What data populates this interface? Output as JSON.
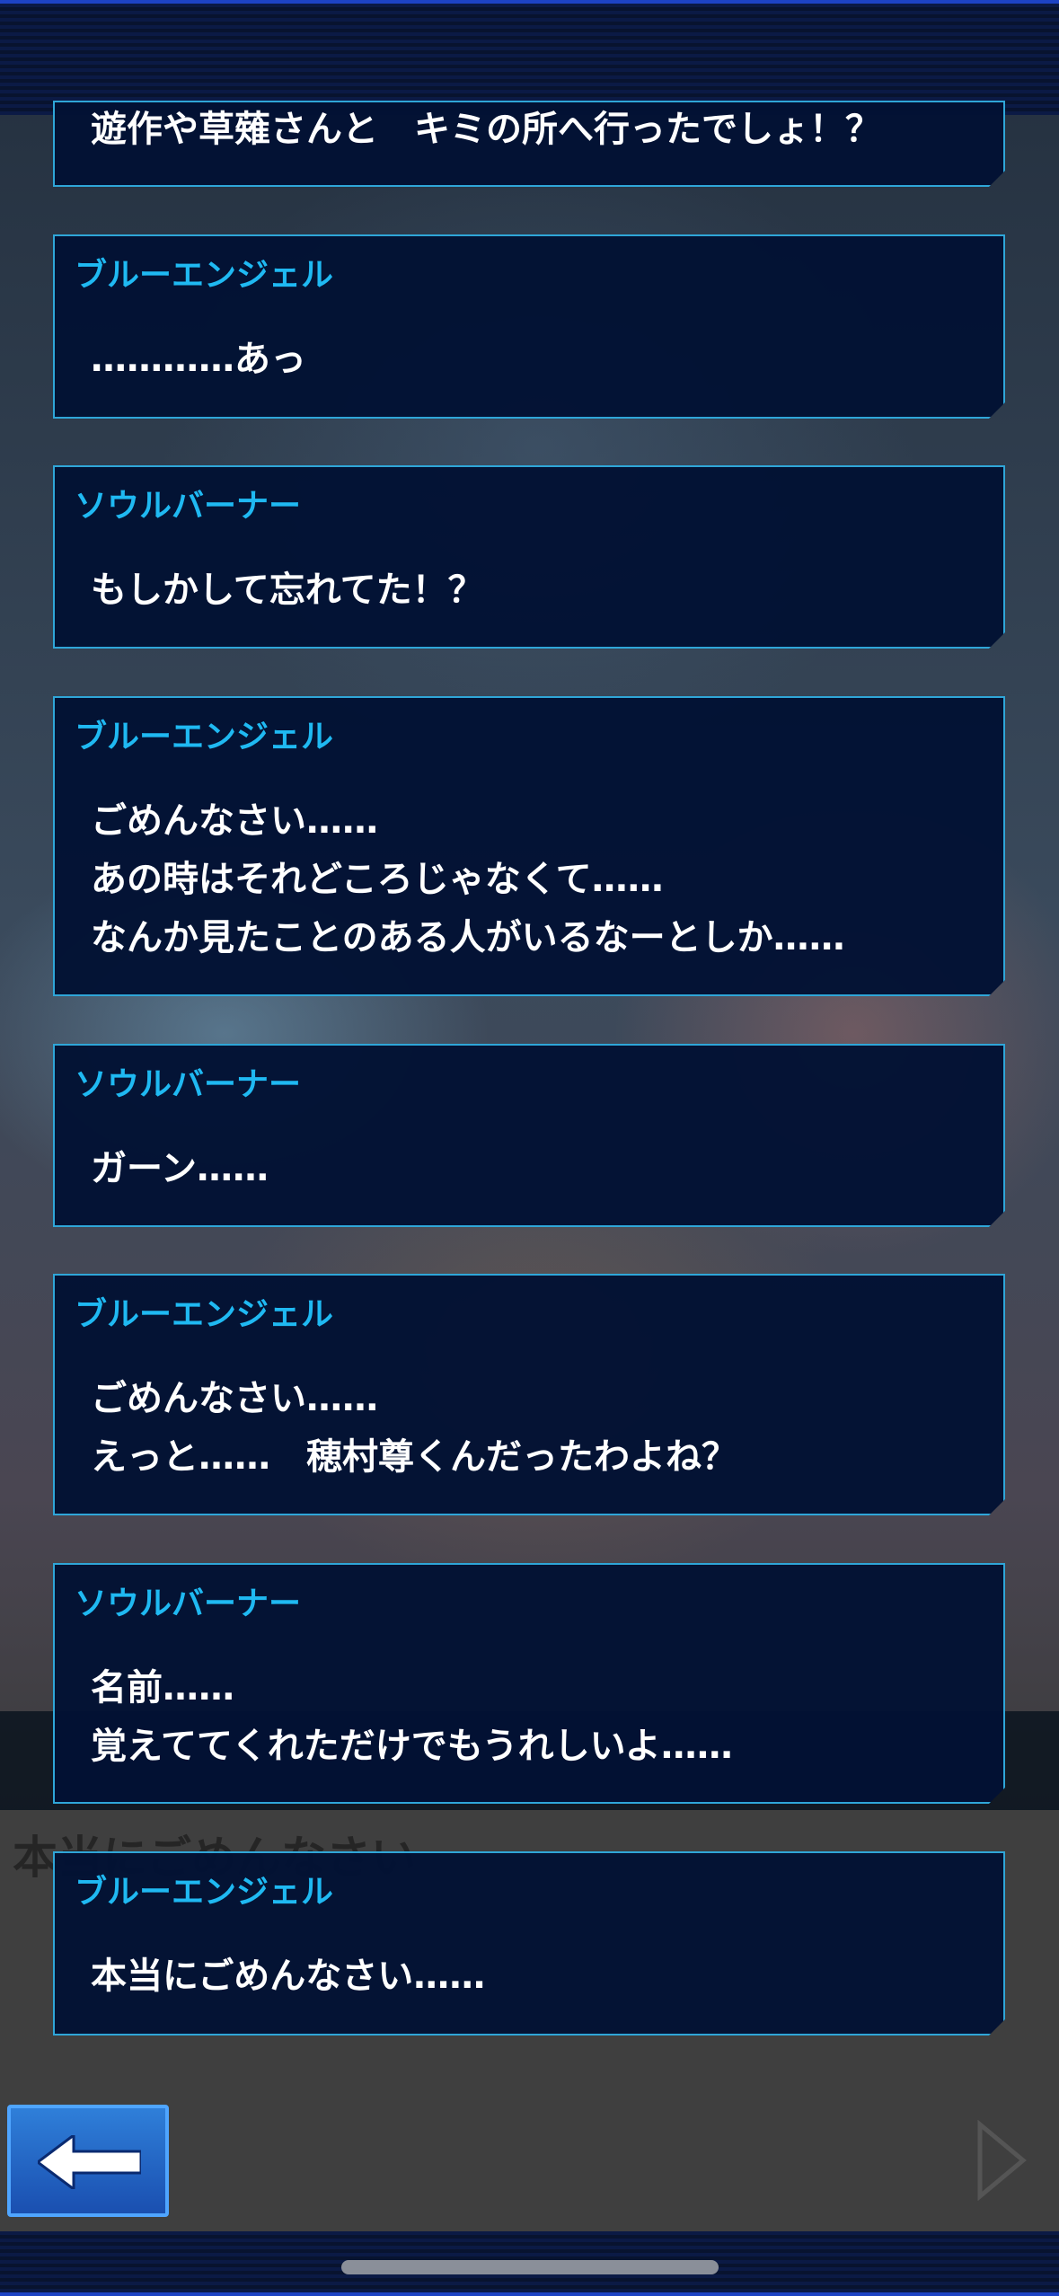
{
  "dialogue": [
    {
      "speaker": "",
      "lines": [
        "遊作や草薙さんと　キミの所へ行ったでしょ！？"
      ]
    },
    {
      "speaker": "ブルーエンジェル",
      "lines": [
        "…………あっ"
      ]
    },
    {
      "speaker": "ソウルバーナー",
      "lines": [
        "もしかして忘れてた！？"
      ]
    },
    {
      "speaker": "ブルーエンジェル",
      "lines": [
        "ごめんなさい……",
        "あの時はそれどころじゃなくて……",
        "なんか見たことのある人がいるなーとしか……"
      ]
    },
    {
      "speaker": "ソウルバーナー",
      "lines": [
        "ガーン……"
      ]
    },
    {
      "speaker": "ブルーエンジェル",
      "lines": [
        "ごめんなさい……",
        "えっと……　穂村尊くんだったわよね？"
      ]
    },
    {
      "speaker": "ソウルバーナー",
      "lines": [
        "名前……",
        "覚えててくれただけでもうれしいよ……"
      ]
    },
    {
      "speaker": "ブルーエンジェル",
      "lines": [
        "本当にごめんなさい……"
      ]
    }
  ],
  "background_text": "本当にごめんなさい",
  "controls": {
    "back_icon": "left-arrow-icon",
    "next_icon": "right-triangle-icon"
  },
  "colors": {
    "speaker": "#1fb9f2",
    "box_border": "#2fa6d8",
    "box_bg": "#021234"
  }
}
